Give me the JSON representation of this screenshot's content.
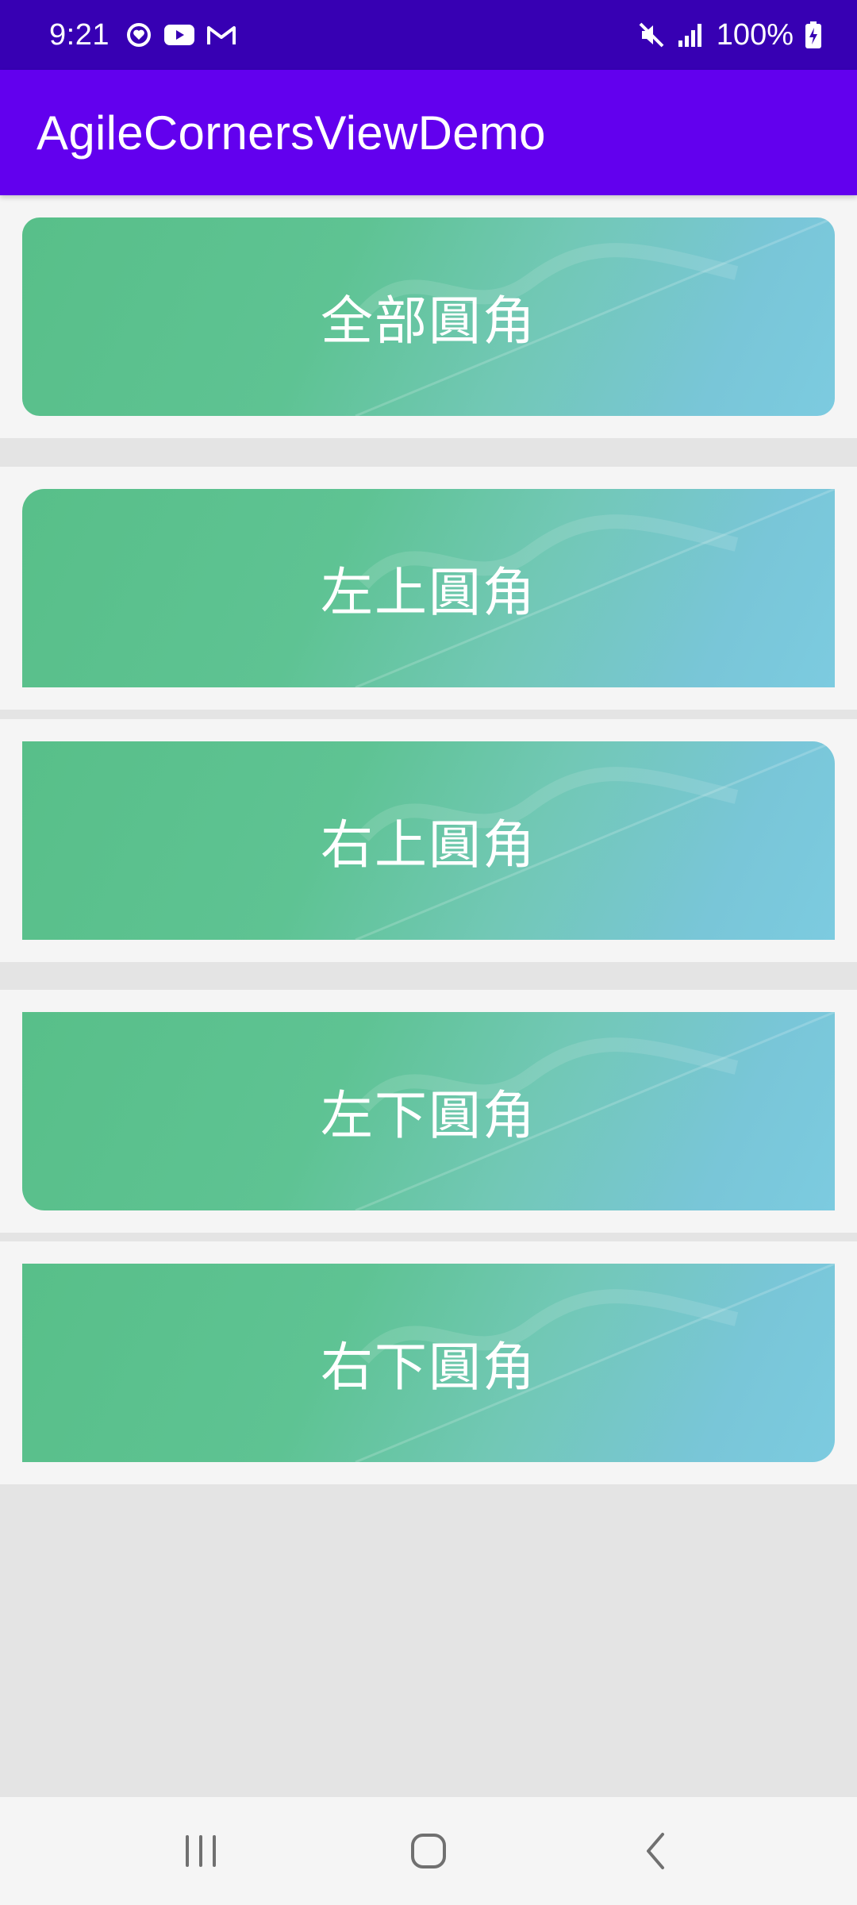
{
  "status_bar": {
    "time": "9:21",
    "battery_percent": "100%",
    "left_icons": [
      "sync-heart-icon",
      "youtube-icon",
      "gmail-icon"
    ],
    "right_icons": [
      "mute-icon",
      "signal-icon",
      "battery-charging-icon"
    ]
  },
  "app_bar": {
    "title": "AgileCornersViewDemo",
    "color": "#6200ee"
  },
  "status_color": "#3700b3",
  "cards": [
    {
      "label": "全部圓角"
    },
    {
      "label": "左上圓角"
    },
    {
      "label": "右上圓角"
    },
    {
      "label": "左下圓角"
    },
    {
      "label": "右下圓角"
    }
  ],
  "nav_bar": {
    "buttons": [
      "recent-apps-icon",
      "home-icon",
      "back-icon"
    ]
  }
}
